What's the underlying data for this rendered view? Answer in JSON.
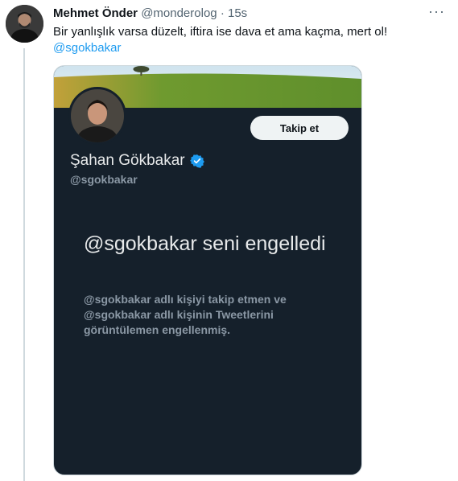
{
  "tweet": {
    "author_name": "Mehmet Önder",
    "author_handle": "@monderolog",
    "separator": "·",
    "time": "15s",
    "more_icon": "···",
    "text": "Bir yanlışlık varsa düzelt, iftira ise dava et ama kaçma, mert ol!",
    "mention": "@sgokbakar"
  },
  "screenshot_card": {
    "follow_label": "Takip et",
    "profile_name": "Şahan Gökbakar",
    "profile_handle": "@sgokbakar",
    "verified_icon": "verified-badge-icon",
    "blocked_title": "@sgokbakar seni engelledi",
    "blocked_description": "@sgokbakar adlı kişiyi takip etmen ve @sgokbakar adlı kişinin Tweetlerini görüntülemen engellenmiş."
  },
  "colors": {
    "accent": "#1d9bf0",
    "card_background": "#15202b",
    "secondary_text": "#536471",
    "verified": "#1d9bf0"
  }
}
